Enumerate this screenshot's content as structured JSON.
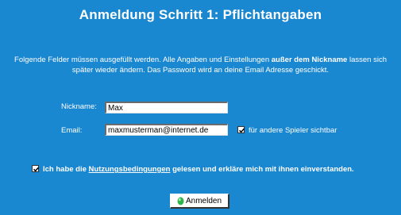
{
  "page": {
    "title": "Anmeldung Schritt 1: Pflichtangaben",
    "intro_part1": "Folgende Felder müssen ausgefüllt werden. Alle Angaben und Einstellungen ",
    "intro_bold": "außer dem Nickname",
    "intro_part2": " lassen sich später wieder ändern. Das Password wird an deine Email Adresse geschickt."
  },
  "form": {
    "nickname_label": "Nickname:",
    "nickname_value": "Max",
    "email_label": "Email:",
    "email_value": "maxmusterman@internet.de",
    "email_visible_checked": true,
    "email_visible_label": "für andere Spieler sichtbar",
    "terms_checked": true,
    "terms_prefix": "Ich habe die ",
    "terms_link": "Nutzungsbedingungen",
    "terms_suffix": " gelesen und erkläre mich mit ihnen einverstanden.",
    "submit_label": "Anmelden"
  },
  "colors": {
    "background": "#1a87d1",
    "text": "#ffffff",
    "submit_icon": "#2fb44a"
  },
  "icons": {
    "submit_icon": "green-dot-icon",
    "checkbox_mark": "checkmark-icon"
  }
}
